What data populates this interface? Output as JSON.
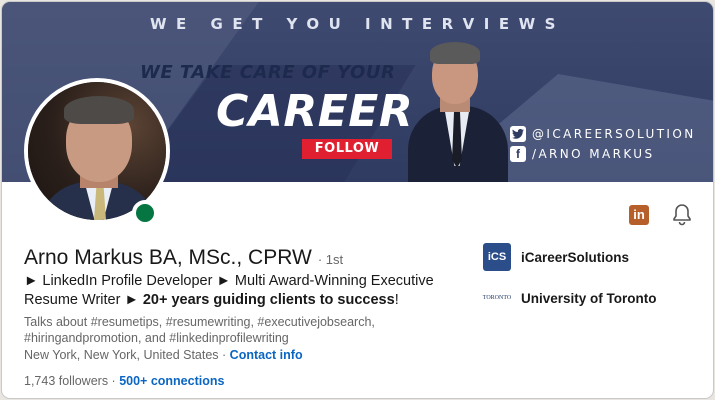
{
  "banner": {
    "tagline": "WE GET YOU INTERVIEWS",
    "sub_headline": "WE TAKE CARE OF YOUR",
    "headline": "CAREER",
    "follow_label": "FOLLOW",
    "twitter_handle": "@ICAREERSOLUTION",
    "facebook_handle": "/ARNO MARKUS",
    "twitter_icon": "twitter-icon",
    "facebook_icon": "facebook-icon"
  },
  "profile": {
    "name": "Arno Markus BA, MSc., CPRW",
    "degree": "· 1st",
    "headline_part1": "► LinkedIn Profile Developer ► Multi Award-Winning Executive Resume Writer ► ",
    "headline_bold": "20+ years guiding clients to success",
    "headline_end": "!",
    "talks_about": "Talks about #resumetips, #resumewriting, #executivejobsearch, #hiringandpromotion, and #linkedinprofilewriting",
    "location": "New York, New York, United States · ",
    "contact_info": "Contact info",
    "followers": "1,743 followers · ",
    "connections": "500+ connections",
    "status": "online"
  },
  "actions": {
    "linkedin_icon": "linkedin-icon",
    "bell_icon": "bell-icon"
  },
  "experience": {
    "company": "iCareerSolutions",
    "company_logo_text": "iCS",
    "school": "University of Toronto",
    "school_logo_text": "TORONTO"
  },
  "colors": {
    "banner": "#2f3b61",
    "follow_red": "#e02030",
    "link_blue": "#0a66c2",
    "online_green": "#057642",
    "linkedin_orange": "#b75f2b"
  }
}
